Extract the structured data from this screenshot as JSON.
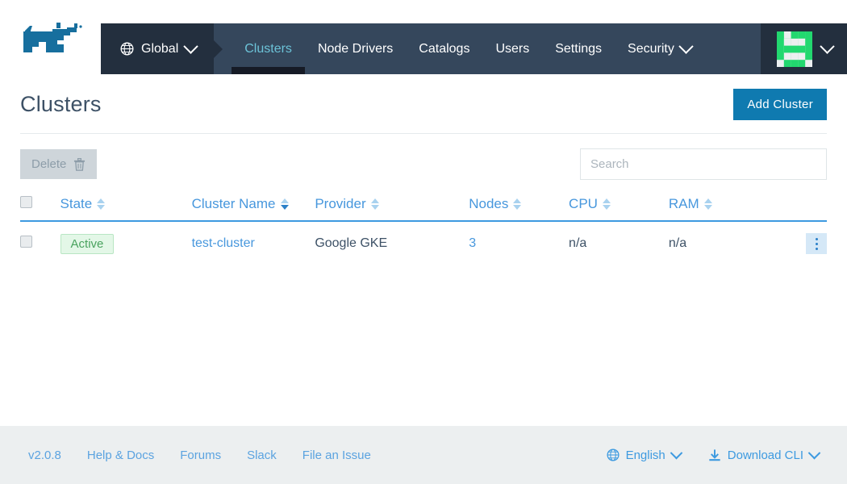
{
  "colors": {
    "navbar_bg": "#35475c",
    "navbar_dark": "#232f3e",
    "accent_blue": "#0f7ab0",
    "link_blue": "#4797dd",
    "active_tab": "#6cc3d8",
    "badge_green": "#4aa35f",
    "footer_bg": "#eceff0"
  },
  "header": {
    "logo_name": "rancher-cow-logo",
    "context": {
      "icon": "globe-icon",
      "label": "Global",
      "chevron": "chevron-down-icon"
    },
    "nav_items": [
      {
        "label": "Clusters",
        "active": true,
        "has_chevron": false
      },
      {
        "label": "Node Drivers",
        "active": false,
        "has_chevron": false
      },
      {
        "label": "Catalogs",
        "active": false,
        "has_chevron": false
      },
      {
        "label": "Users",
        "active": false,
        "has_chevron": false
      },
      {
        "label": "Settings",
        "active": false,
        "has_chevron": false
      },
      {
        "label": "Security",
        "active": false,
        "has_chevron": true
      }
    ],
    "user_menu": {
      "avatar_name": "user-avatar-identicon",
      "avatar_color": "#22d86f",
      "chevron": "chevron-down-icon"
    }
  },
  "page": {
    "title": "Clusters",
    "add_cluster_label": "Add Cluster"
  },
  "toolbar": {
    "delete_label": "Delete",
    "delete_icon": "trash-icon",
    "delete_disabled": true,
    "search_placeholder": "Search",
    "search_value": ""
  },
  "table": {
    "columns": [
      {
        "key": "state",
        "label": "State",
        "sortable": true,
        "sorted": false
      },
      {
        "key": "name",
        "label": "Cluster Name",
        "sortable": true,
        "sorted": true
      },
      {
        "key": "provider",
        "label": "Provider",
        "sortable": true,
        "sorted": false
      },
      {
        "key": "nodes",
        "label": "Nodes",
        "sortable": true,
        "sorted": false
      },
      {
        "key": "cpu",
        "label": "CPU",
        "sortable": true,
        "sorted": false
      },
      {
        "key": "ram",
        "label": "RAM",
        "sortable": true,
        "sorted": false
      }
    ],
    "rows": [
      {
        "state": "Active",
        "name": "test-cluster",
        "provider": "Google GKE",
        "nodes": "3",
        "cpu": "n/a",
        "ram": "n/a"
      }
    ]
  },
  "footer": {
    "links": [
      {
        "label": "v2.0.8"
      },
      {
        "label": "Help & Docs"
      },
      {
        "label": "Forums"
      },
      {
        "label": "Slack"
      },
      {
        "label": "File an Issue"
      }
    ],
    "language": {
      "icon": "globe-icon",
      "label": "English",
      "chevron": "chevron-down-icon"
    },
    "download": {
      "icon": "download-icon",
      "label": "Download CLI",
      "chevron": "chevron-down-icon"
    }
  }
}
